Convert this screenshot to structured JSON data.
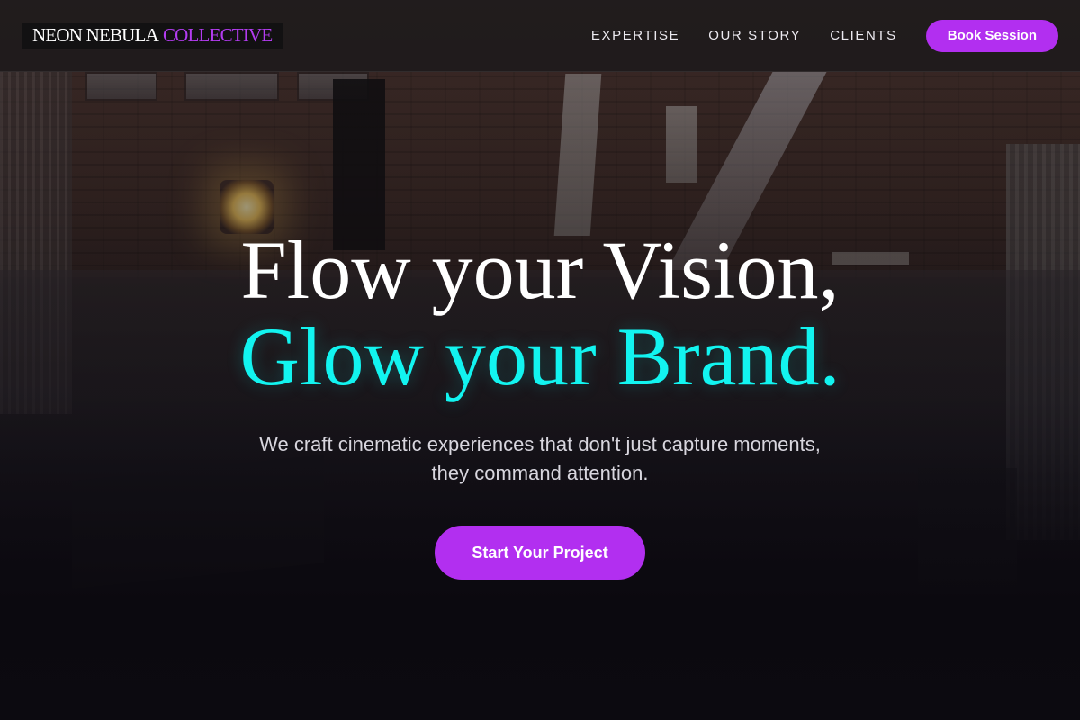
{
  "brand": {
    "name_part1": "NEON NEBULA",
    "name_part2": "COLLECTIVE",
    "accent_color": "#b22ff0"
  },
  "nav": {
    "links": [
      "EXPERTISE",
      "OUR STORY",
      "CLIENTS"
    ],
    "cta_label": "Book Session"
  },
  "hero": {
    "headline_line1": "Flow your Vision,",
    "headline_line2": "Glow your Brand.",
    "headline_line2_color": "#12f4f0",
    "subheadline": "We craft cinematic experiences that don't just capture moments, they command attention.",
    "cta_label": "Start Your Project"
  }
}
